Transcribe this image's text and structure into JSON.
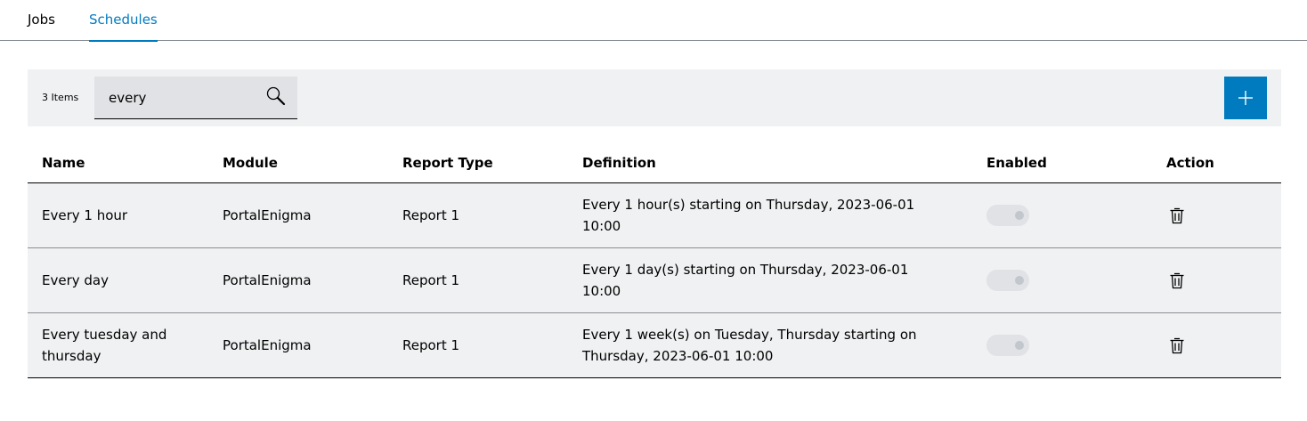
{
  "tabs": [
    {
      "label": "Jobs",
      "active": false
    },
    {
      "label": "Schedules",
      "active": true
    }
  ],
  "toolbar": {
    "item_count": "3 Items",
    "search_value": "every",
    "search_icon": "search-icon",
    "add_icon": "plus-icon"
  },
  "table": {
    "headers": {
      "name": "Name",
      "module": "Module",
      "report_type": "Report Type",
      "definition": "Definition",
      "enabled": "Enabled",
      "action": "Action"
    },
    "rows": [
      {
        "name": "Every 1 hour",
        "module": "PortalEnigma",
        "report_type": "Report 1",
        "definition": "Every 1 hour(s) starting on Thursday, 2023-06-01 10:00",
        "enabled": false
      },
      {
        "name": "Every day",
        "module": "PortalEnigma",
        "report_type": "Report 1",
        "definition": "Every 1 day(s) starting on Thursday, 2023-06-01 10:00",
        "enabled": false
      },
      {
        "name": "Every tuesday and thursday",
        "module": "PortalEnigma",
        "report_type": "Report 1",
        "definition": "Every 1 week(s) on Tuesday, Thursday starting on Thursday, 2023-06-01 10:00",
        "enabled": false
      }
    ]
  },
  "colors": {
    "accent": "#007bc0",
    "toolbar_bg": "#eff1f2",
    "row_bg": "#eff1f2"
  }
}
